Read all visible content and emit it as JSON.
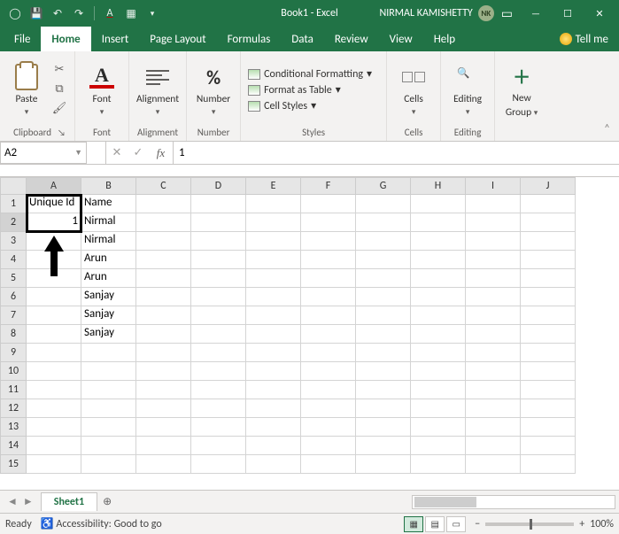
{
  "titlebar": {
    "title": "Book1 - Excel",
    "user_name": "NIRMAL KAMISHETTY",
    "user_initials": "NK"
  },
  "tabs": {
    "file": "File",
    "home": "Home",
    "insert": "Insert",
    "page_layout": "Page Layout",
    "formulas": "Formulas",
    "data": "Data",
    "review": "Review",
    "view": "View",
    "help": "Help",
    "tell_me": "Tell me"
  },
  "ribbon": {
    "clipboard": {
      "paste": "Paste",
      "label": "Clipboard"
    },
    "font": {
      "btn": "Font",
      "label": "Font"
    },
    "alignment": {
      "btn": "Alignment",
      "label": "Alignment"
    },
    "number": {
      "btn": "Number",
      "label": "Number"
    },
    "styles": {
      "cond_fmt": "Conditional Formatting",
      "as_table": "Format as Table",
      "cell_styles": "Cell Styles",
      "label": "Styles"
    },
    "cells": {
      "btn": "Cells",
      "label": "Cells"
    },
    "editing": {
      "btn": "Editing",
      "label": "Editing"
    },
    "newgroup": {
      "btn": "New\nGroup",
      "label_line1": "New",
      "label_line2": "Group"
    }
  },
  "namebox": "A2",
  "formula_value": "1",
  "columns": [
    "A",
    "B",
    "C",
    "D",
    "E",
    "F",
    "G",
    "H",
    "I",
    "J"
  ],
  "row_count": 15,
  "selected": {
    "col": "A",
    "row": 2
  },
  "cells": {
    "A1": "Unique Id",
    "B1": "Name",
    "A2": "1",
    "B2": "Nirmal",
    "B3": "Nirmal",
    "B4": "Arun",
    "B5": "Arun",
    "B6": "Sanjay",
    "B7": "Sanjay",
    "B8": "Sanjay"
  },
  "sheets": {
    "active": "Sheet1"
  },
  "status": {
    "ready": "Ready",
    "accessibility": "Accessibility: Good to go",
    "zoom": "100%"
  }
}
